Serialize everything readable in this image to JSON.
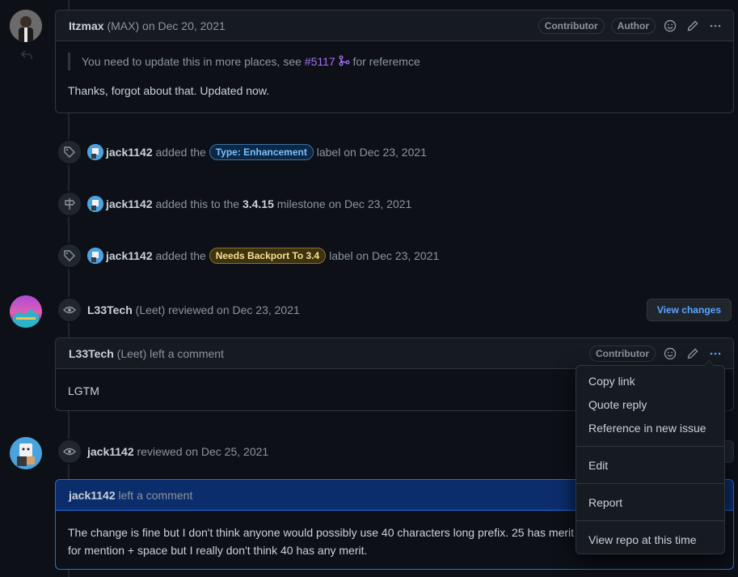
{
  "comment1": {
    "author": "Itzmax",
    "author_full": "(MAX)",
    "date_text": "on Dec 20, 2021",
    "badges": [
      "Contributor",
      "Author"
    ],
    "quote_prefix": "You need to update this in more places, see",
    "quote_link": "#5117",
    "quote_suffix": "for referemce",
    "body": "Thanks, forgot about that. Updated now."
  },
  "events": [
    {
      "user": "jack1142",
      "pre": "added the",
      "label": "Type: Enhancement",
      "post": "label on Dec 23, 2021",
      "label_bg": "#0d2845",
      "label_fg": "#7cc0ff",
      "label_border": "#3b6fa3"
    },
    {
      "user": "jack1142",
      "pre": "added this to the",
      "milestone": "3.4.15",
      "post": "milestone on Dec 23, 2021"
    },
    {
      "user": "jack1142",
      "pre": "added the",
      "label": "Needs Backport To 3.4",
      "post": "label on Dec 23, 2021",
      "label_bg": "#3d3212",
      "label_fg": "#f7e18b",
      "label_border": "#8a7327"
    }
  ],
  "review1": {
    "user": "L33Tech",
    "full": "(Leet)",
    "text": "reviewed on Dec 23, 2021",
    "button": "View changes"
  },
  "comment2": {
    "author": "L33Tech",
    "author_full": "(Leet)",
    "action": "left a comment",
    "badge": "Contributor",
    "body": "LGTM"
  },
  "review2": {
    "user": "jack1142",
    "text": "reviewed on Dec 25, 2021"
  },
  "comment3": {
    "author": "jack1142",
    "action": "left a comment",
    "body_line1": "The change is fine but I don't think anyone would possibly use 40 characters long prefix. 25 has merit",
    "body_line2": "for mention + space but I really don't think 40 has any merit."
  },
  "menu": {
    "items_top": [
      "Copy link",
      "Quote reply",
      "Reference in new issue"
    ],
    "items_mid": [
      "Edit"
    ],
    "items_report": [
      "Report"
    ],
    "items_bottom": [
      "View repo at this time"
    ]
  },
  "colors": {
    "accent": "#58a6ff",
    "purple_link": "#a371f7"
  }
}
